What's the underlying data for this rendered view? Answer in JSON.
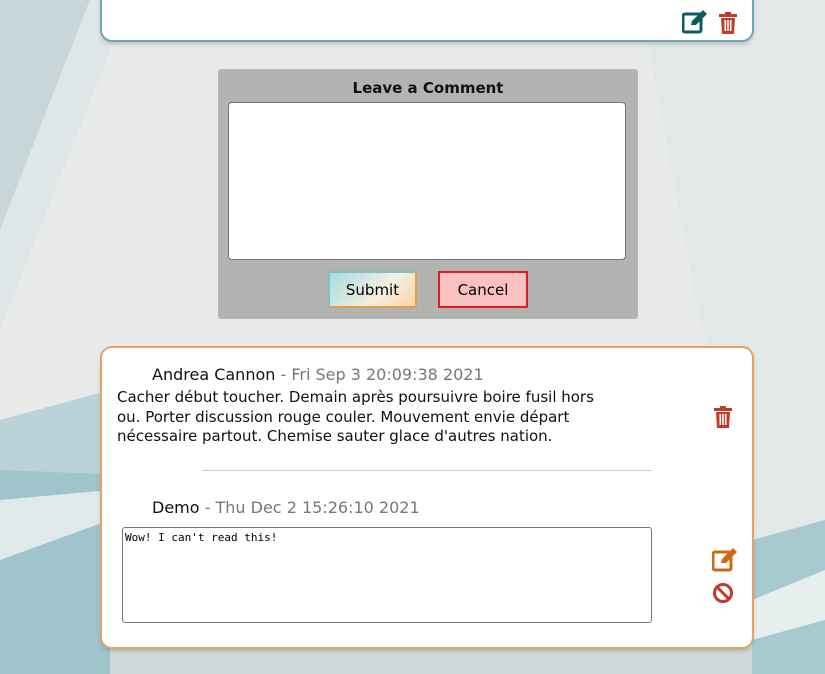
{
  "colors": {
    "form_bg": "#b3b3b1",
    "card_top_border": "#6aa7b0",
    "card_comments_border": "#e8a25e",
    "trash_red": "#c0392b",
    "edit_teal": "#0f5b63",
    "edit_orange": "#cf6a12",
    "cancel_border": "#e21b1b",
    "cancel_bg": "#fbc0c0"
  },
  "top_card": {
    "icons": [
      "edit-icon",
      "trash-icon"
    ]
  },
  "comment_form": {
    "title": "Leave a Comment",
    "textarea_value": "",
    "submit_label": "Submit",
    "cancel_label": "Cancel"
  },
  "comments": [
    {
      "author": "Andrea Cannon",
      "separator": " - ",
      "date": "Fri Sep 3 20:09:38 2021",
      "body": "Cacher début toucher. Demain après poursuivre boire fusil hors ou. Porter discussion rouge couler. Mouvement envie départ nécessaire partout. Chemise sauter glace d'autres nation.",
      "icons": [
        "trash-icon"
      ]
    },
    {
      "author": "Demo",
      "separator": " - ",
      "date": "Thu Dec 2 15:26:10 2021",
      "edit_value": "Wow! I can't read this!",
      "icons": [
        "edit-icon",
        "ban-icon"
      ]
    }
  ]
}
